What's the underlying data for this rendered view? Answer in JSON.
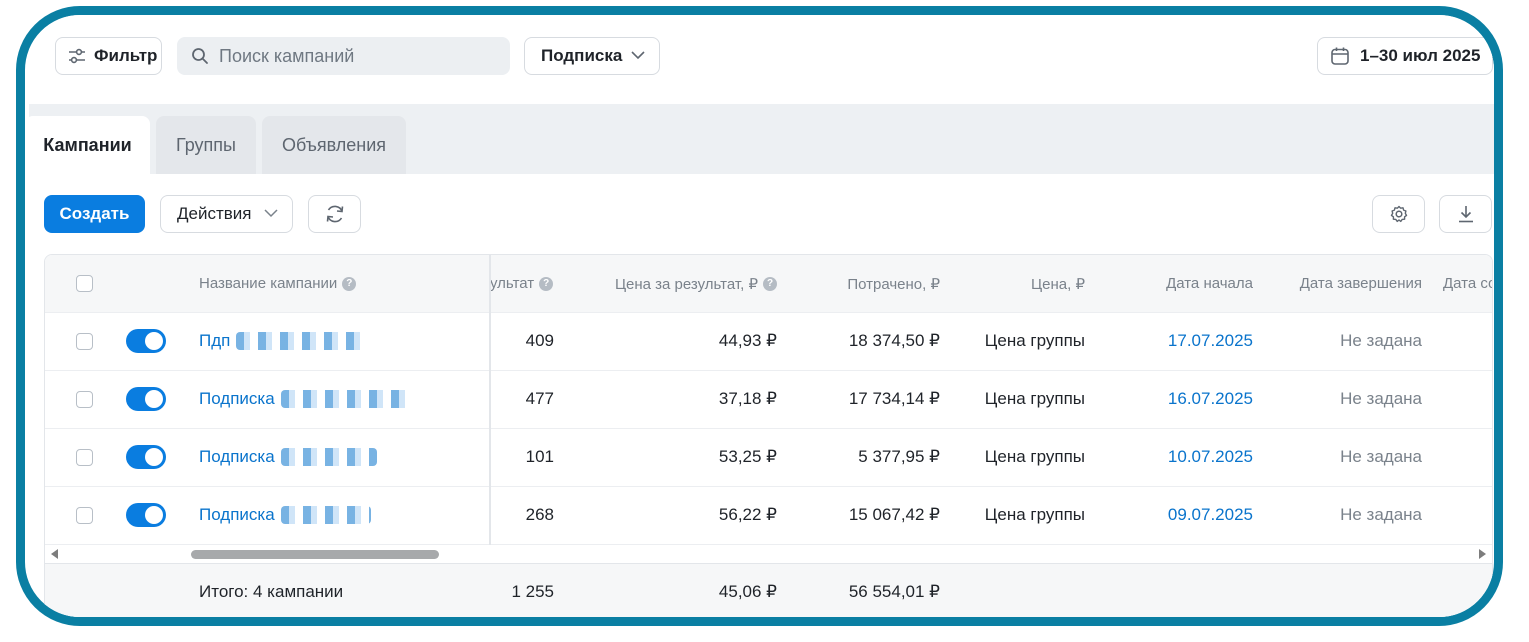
{
  "toolbar": {
    "filter_label": "Фильтр",
    "search_placeholder": "Поиск кампаний",
    "objective_select": "Подписка",
    "date_range": "1–30 июл 2025"
  },
  "tabs": [
    {
      "label": "Кампании",
      "active": true
    },
    {
      "label": "Группы",
      "active": false
    },
    {
      "label": "Объявления",
      "active": false
    }
  ],
  "actions": {
    "create_label": "Создать",
    "actions_label": "Действия"
  },
  "table": {
    "headers": {
      "name": "Название кампании",
      "result": "ультат",
      "cost_per_result": "Цена за результат, ₽",
      "spent": "Потрачено, ₽",
      "price": "Цена, ₽",
      "start_date": "Дата начала",
      "end_date": "Дата завершения",
      "created_date": "Дата со"
    },
    "rows": [
      {
        "name": "Пдп",
        "result": "409",
        "cost_per_result": "44,93 ₽",
        "spent": "18 374,50 ₽",
        "price": "Цена группы",
        "start_date": "17.07.2025",
        "end_date": "Не задана",
        "enabled": true
      },
      {
        "name": "Подписка",
        "result": "477",
        "cost_per_result": "37,18 ₽",
        "spent": "17 734,14 ₽",
        "price": "Цена группы",
        "start_date": "16.07.2025",
        "end_date": "Не задана",
        "enabled": true
      },
      {
        "name": "Подписка",
        "result": "101",
        "cost_per_result": "53,25 ₽",
        "spent": "5 377,95 ₽",
        "price": "Цена группы",
        "start_date": "10.07.2025",
        "end_date": "Не задана",
        "enabled": true
      },
      {
        "name": "Подписка",
        "result": "268",
        "cost_per_result": "56,22 ₽",
        "spent": "15 067,42 ₽",
        "price": "Цена группы",
        "start_date": "09.07.2025",
        "end_date": "Не задана",
        "enabled": true
      }
    ],
    "totals": {
      "label": "Итого: 4 кампании",
      "result": "1 255",
      "cost_per_result": "45,06 ₽",
      "spent": "56 554,01 ₽"
    }
  },
  "colors": {
    "frame": "#0a7fa3",
    "accent": "#0a7de0",
    "link": "#0a74cc"
  }
}
